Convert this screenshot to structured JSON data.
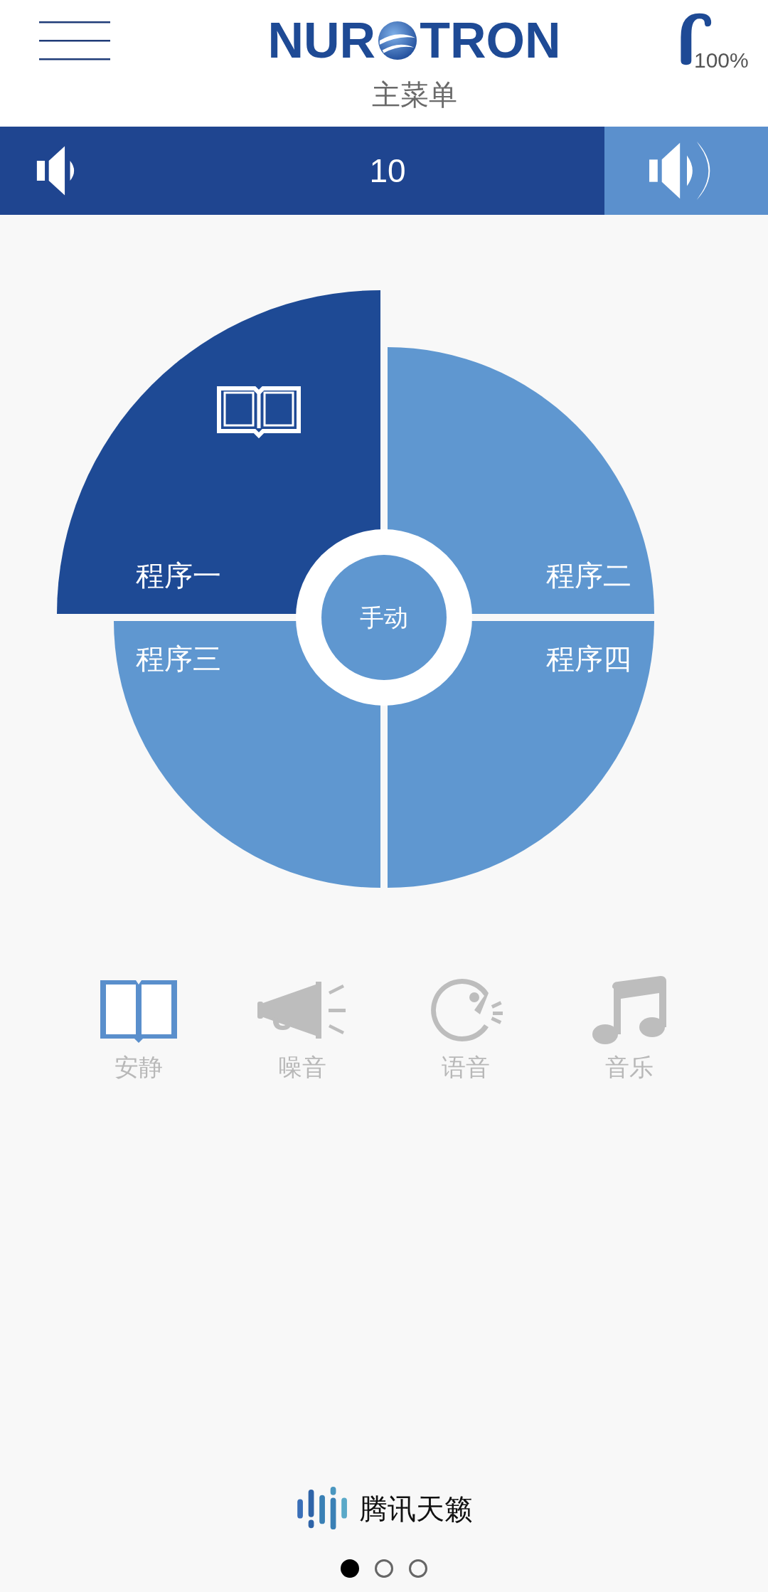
{
  "header": {
    "logo_left": "NUR",
    "logo_right": "TRON",
    "title": "主菜单",
    "battery": "100%"
  },
  "volume": {
    "value": "10"
  },
  "programs": [
    {
      "label": "程序一",
      "selected": true
    },
    {
      "label": "程序二",
      "selected": false
    },
    {
      "label": "程序三",
      "selected": false
    },
    {
      "label": "程序四",
      "selected": false
    }
  ],
  "center_button": "手动",
  "modes": [
    {
      "kind": "book",
      "label": "安静",
      "selected": true
    },
    {
      "kind": "megaphone",
      "label": "噪音",
      "selected": false
    },
    {
      "kind": "speech",
      "label": "语音",
      "selected": false
    },
    {
      "kind": "music",
      "label": "音乐",
      "selected": false
    }
  ],
  "footer": {
    "brand": "腾讯天籁"
  },
  "pages": [
    {
      "selected": true
    },
    {
      "selected": false
    },
    {
      "selected": false
    }
  ]
}
